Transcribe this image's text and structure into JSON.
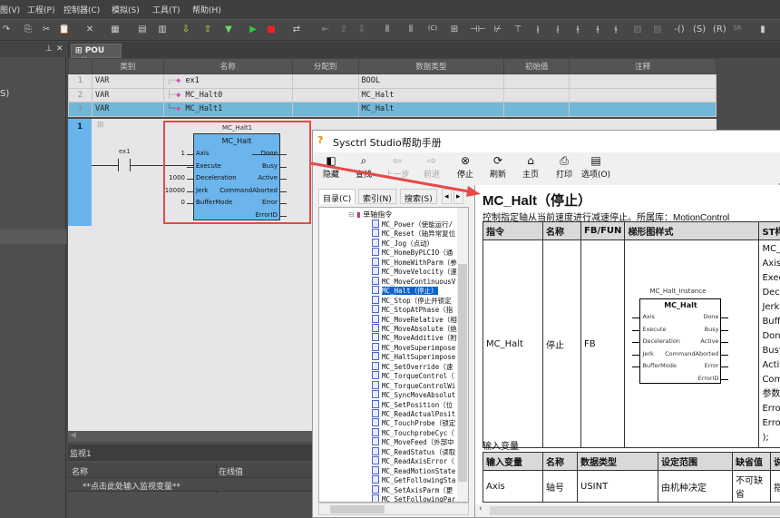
{
  "menu": [
    "图(V)",
    "工程(P)",
    "控制器(C)",
    "模拟(S)",
    "工具(T)",
    "帮助(H)"
  ],
  "left_panel": {
    "text": "S)"
  },
  "tab": {
    "label": "POU"
  },
  "var_table": {
    "headers": [
      "类别",
      "名称",
      "分配到",
      "数据类型",
      "初始值",
      "注释"
    ],
    "rows": [
      {
        "num": "1",
        "kind": "VAR",
        "name": "ex1",
        "assign": "",
        "type": "BOOL",
        "init": "",
        "comment": ""
      },
      {
        "num": "2",
        "kind": "VAR",
        "name": "MC_Halt0",
        "assign": "",
        "type": "MC_Halt",
        "init": "",
        "comment": ""
      },
      {
        "num": "3",
        "kind": "VAR",
        "name": "MC_Halt1",
        "assign": "",
        "type": "MC_Halt",
        "init": "",
        "comment": "",
        "selected": true
      }
    ]
  },
  "ladder": {
    "rung": "1",
    "contact": "ex1",
    "instance": "MC_Halt1",
    "fb_name": "MC_Halt",
    "inputs": [
      {
        "pin": "Axis",
        "value": "1"
      },
      {
        "pin": "Execute",
        "value": ""
      },
      {
        "pin": "Deceleration",
        "value": "1000"
      },
      {
        "pin": "Jerk",
        "value": "10000"
      },
      {
        "pin": "BufferMode",
        "value": "0"
      }
    ],
    "outputs": [
      "Done",
      "Busy",
      "Active",
      "CommandAborted",
      "Error",
      "ErrorID"
    ]
  },
  "monitor": {
    "title": "监视1",
    "col_name": "名称",
    "col_value": "在线值",
    "placeholder": "**点击此处输入监视变量**"
  },
  "help": {
    "title": "Sysctrl Studio帮助手册",
    "toolbar": [
      {
        "label": "隐藏",
        "icon": "hide-icon",
        "enabled": true
      },
      {
        "label": "查找",
        "icon": "find-icon",
        "enabled": true
      },
      {
        "label": "上一步",
        "icon": "back-icon",
        "enabled": false
      },
      {
        "label": "前进",
        "icon": "forward-icon",
        "enabled": false
      },
      {
        "label": "停止",
        "icon": "stop-icon",
        "enabled": true
      },
      {
        "label": "刷新",
        "icon": "refresh-icon",
        "enabled": true
      },
      {
        "label": "主页",
        "icon": "home-icon",
        "enabled": true
      },
      {
        "label": "打印",
        "icon": "print-icon",
        "enabled": true
      },
      {
        "label": "选项(O)",
        "icon": "options-icon",
        "enabled": true
      }
    ],
    "nav_tabs": [
      "目录(C)",
      "索引(N)",
      "搜索(S)"
    ],
    "tree_folder": "单轴指令",
    "tree_items": [
      "MC_Power（使能运行/",
      "MC_Reset（轴异常复位",
      "MC_Jog（点动）",
      "MC_HomeByPLCIO（通",
      "MC_HomeWithParm（参",
      "MC_MoveVelocity（速",
      "MC_MoveContinuousV",
      "MC_Halt（停止）",
      "MC_Stop（停止并锁定",
      "MC_StopAtPhase（指",
      "MC_MoveRelative（相",
      "MC_MoveAbsolute（绝",
      "MC_MoveAdditive（附",
      "MC_MoveSuperimpose",
      "MC_HaltSuperimpose",
      "MC_SetOverride（速",
      "MC_TorqueControl（",
      "MC_TorqueControlWi",
      "MC_SyncMoveAbsolut",
      "MC_SetPosition（位",
      "MC_ReadActualPosit",
      "MC_TouchProbe（锁定",
      "MC_TouchprobeCyc（",
      "MC_MoveFeed（外部中",
      "MC_ReadStatus（读取",
      "MC_ReadAxisError（",
      "MC_ReadMotionState",
      "MC_GetFollowingSta",
      "MC_SetAxisParm（更",
      "MC_SetFollowingPar"
    ],
    "selected_item": 7,
    "page": {
      "heading": "MC_Halt（停止）",
      "desc": "控制指定轴从当前速度进行减速停止。所属库：MotionControl",
      "table_headers": [
        "指令",
        "名称",
        "FB/FUN",
        "梯形图样式",
        "ST样式"
      ],
      "row": {
        "cmd": "MC_Halt",
        "name": "停止",
        "kind": "FB"
      },
      "diagram": {
        "instance": "MC_Halt_Instance",
        "name": "MC_Halt",
        "inputs": [
          "Axis",
          "Execute",
          "Deceleration",
          "Jerk",
          "BufferMode"
        ],
        "outputs": [
          "Done",
          "Busy",
          "Active",
          "CommandAborted",
          "Error",
          "ErrorID"
        ]
      },
      "st_lines": [
        "MC_H",
        "Axis :",
        "Execu",
        "Decel",
        "Jerk:=",
        "Buffer",
        "Done",
        "Busy=",
        "Active",
        "Comm",
        "参数",
        "Error",
        "ErrorI",
        ");"
      ],
      "inputs_title": "输入变量",
      "input_headers": [
        "输入变量",
        "名称",
        "数据类型",
        "设定范围",
        "缺省值",
        "说"
      ],
      "input_rows": [
        {
          "var": "Axis",
          "name": "轴号",
          "type": "USINT",
          "range": "由机种决定",
          "default": "不可缺省",
          "desc": "指"
        }
      ]
    }
  },
  "colors": {
    "accent_red": "#e84848",
    "fb_blue": "#6bb5ec",
    "selection": "#70b8d8"
  }
}
